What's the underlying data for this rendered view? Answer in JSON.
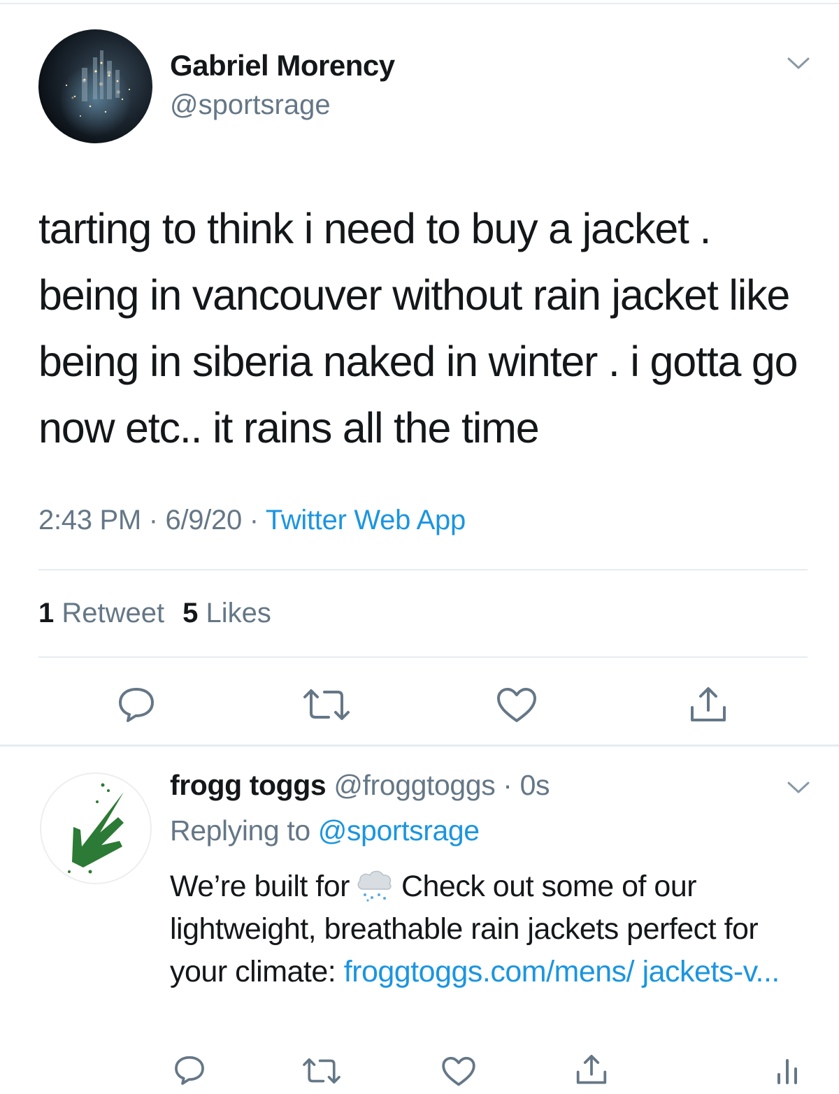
{
  "main_tweet": {
    "author_name": "Gabriel Morency",
    "author_handle": "@sportsrage",
    "text": "tarting to think i need to buy a jacket . being in vancouver without rain jacket like being in siberia naked in winter . i gotta go now etc.. it rains all the time",
    "time": "2:43 PM",
    "date": "6/9/20",
    "separator": " · ",
    "source_app": "Twitter Web App",
    "retweet_count": "1",
    "retweet_label": "Retweet",
    "like_count": "5",
    "like_label": "Likes",
    "actions": [
      "reply-icon",
      "retweet-icon",
      "like-icon",
      "share-icon"
    ]
  },
  "reply_tweet": {
    "author_name": "frogg toggs",
    "author_handle": "@froggtoggs",
    "separator": " · ",
    "time_ago": "0s",
    "replying_prefix": "Replying to ",
    "replying_to": "@sportsrage",
    "text_before_emoji": "We’re built for",
    "emoji": "cloud-with-rain-icon",
    "text_after_emoji": "Check out some of our lightweight, breathable rain jackets perfect for your climate: ",
    "link_text": "froggtoggs.com/mens/ jackets-v...",
    "actions": [
      "reply-icon",
      "retweet-icon",
      "like-icon",
      "share-icon",
      "analytics-icon"
    ]
  },
  "colors": {
    "text": "#14171a",
    "secondary": "#657786",
    "link": "#1b95e0",
    "divider": "#e6ecf0",
    "brand_green": "#2b7a35"
  }
}
